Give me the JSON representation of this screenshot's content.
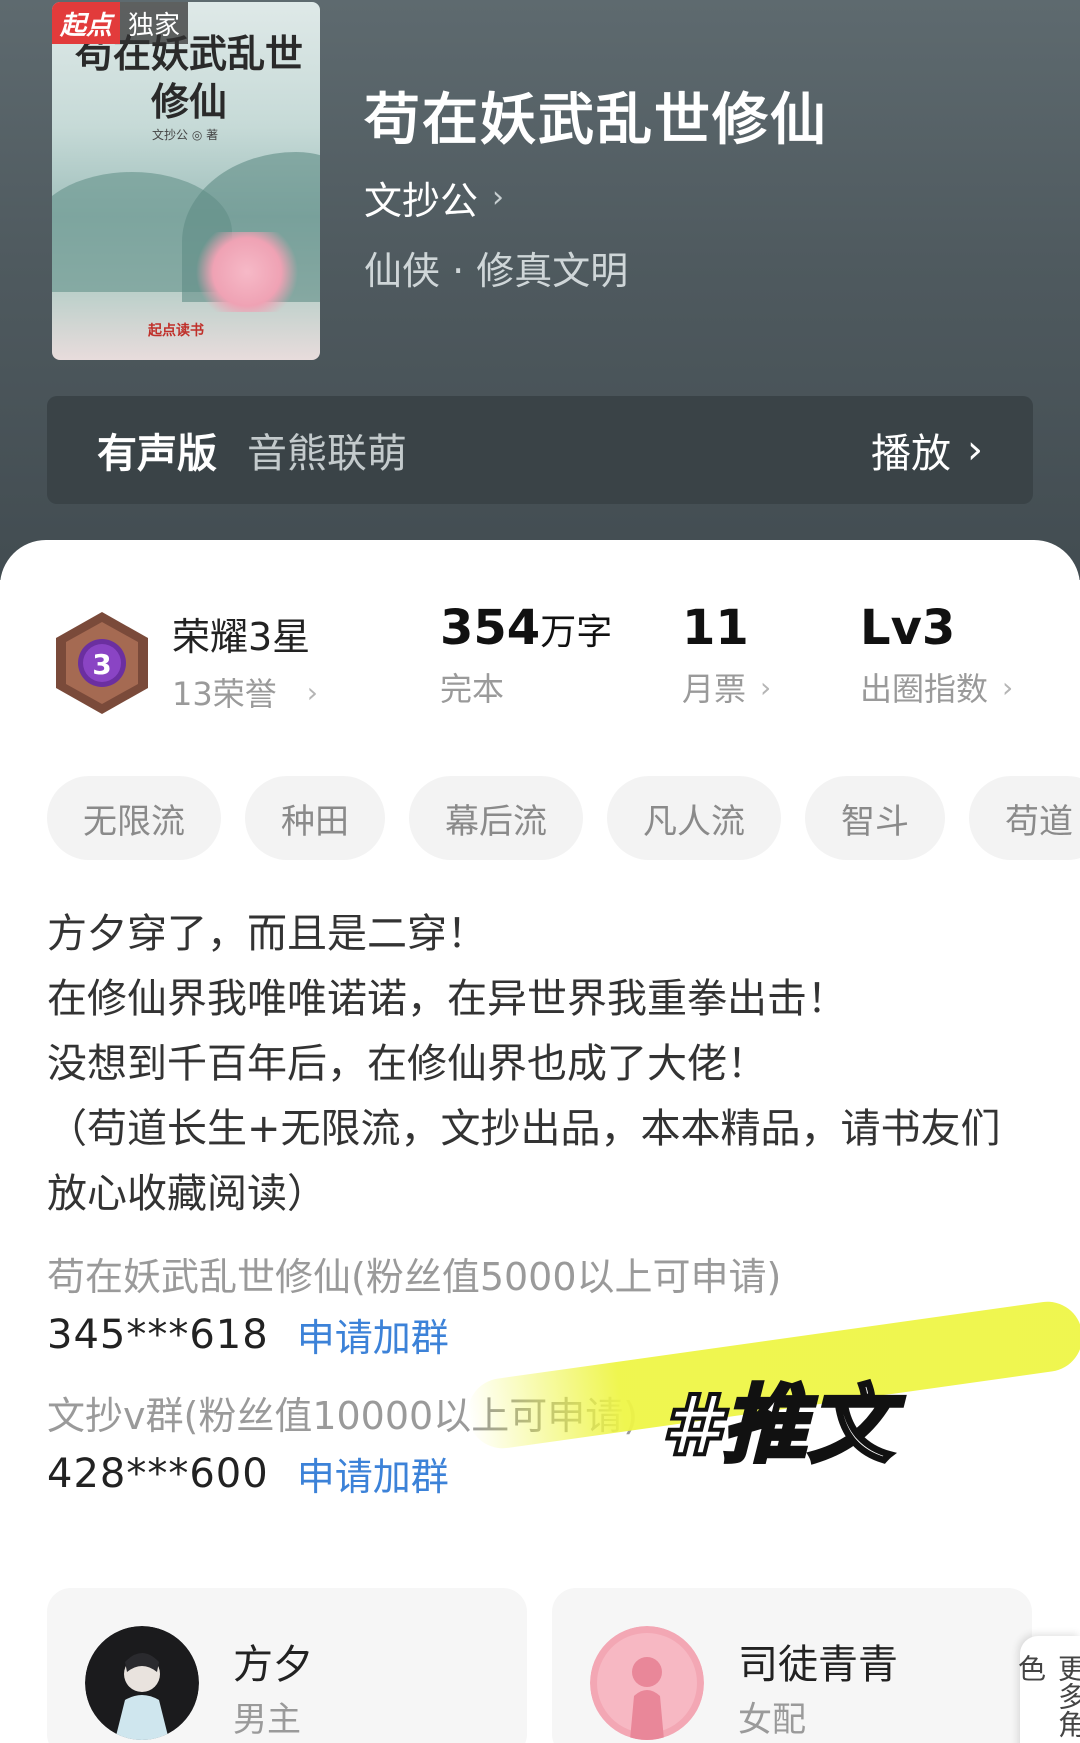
{
  "cover": {
    "badge_brand": "起点",
    "badge_exclusive": "独家",
    "art_title": "苟在妖武乱世修仙",
    "art_author": "文抄公 ◎ 著",
    "art_publisher": "起点读书"
  },
  "book": {
    "title": "苟在妖武乱世修仙",
    "author": "文抄公",
    "genre": "仙侠 · 修真文明"
  },
  "audio": {
    "label": "有声版",
    "narrator": "音熊联萌",
    "play": "播放"
  },
  "stats": {
    "honor_title": "荣耀3星",
    "honor_count": "13荣誉",
    "honor_level": "3",
    "words_value": "354",
    "words_unit": "万字",
    "words_status": "完本",
    "monthly_votes": "11",
    "monthly_label": "月票",
    "index_value": "Lv3",
    "index_label": "出圈指数"
  },
  "tags": [
    "无限流",
    "种田",
    "幕后流",
    "凡人流",
    "智斗",
    "苟道"
  ],
  "description": [
    "方夕穿了，而且是二穿！",
    "在修仙界我唯唯诺诺，在异世界我重拳出击！",
    "没想到千百年后，在修仙界也成了大佬！",
    "（苟道长生+无限流，文抄出品，本本精品，请书友们放心收藏阅读）"
  ],
  "groups": [
    {
      "name": "苟在妖武乱世修仙(粉丝值5000以上可申请)",
      "number": "345***618",
      "action": "申请加群"
    },
    {
      "name": "文抄v群(粉丝值10000以上可申请)",
      "number": "428***600",
      "action": "申请加群"
    }
  ],
  "overlay": {
    "hashtag": "#推文"
  },
  "characters": [
    {
      "name": "方夕",
      "role": "男主"
    },
    {
      "name": "司徒青青",
      "role": "女配"
    }
  ],
  "more_label": "更多角色",
  "colors": {
    "accent_link": "#3c82d8",
    "header_bg": "#4f5a5f",
    "badge_red": "#e23b3b",
    "highlight": "#eef546"
  }
}
